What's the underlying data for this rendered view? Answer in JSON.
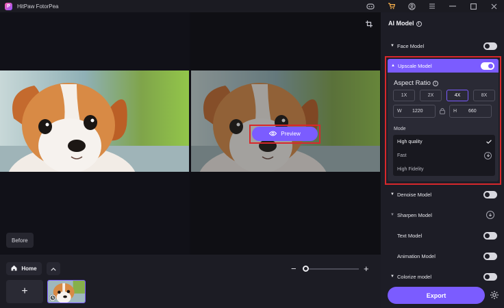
{
  "app": {
    "title": "HitPaw FotorPea",
    "logo_letter": "P"
  },
  "titlebar": {
    "icons": [
      "discord-icon",
      "cart-icon",
      "account-icon",
      "menu-icon",
      "minimize-icon",
      "maximize-icon",
      "close-icon"
    ]
  },
  "canvas": {
    "preview_label": "Preview",
    "before_label": "Before"
  },
  "bottom": {
    "home_label": "Home",
    "add_symbol": "+",
    "zoom_minus": "−",
    "zoom_plus": "+"
  },
  "panel": {
    "title": "AI Model",
    "models": [
      {
        "label": "Face Model",
        "toggle": "off"
      },
      {
        "label": "Upscale Model",
        "toggle": "on",
        "expanded": true
      },
      {
        "label": "Denoise Model",
        "toggle": "off"
      },
      {
        "label": "Sharpen Model",
        "toggle": "download"
      },
      {
        "label": "Text Model",
        "toggle": "off"
      },
      {
        "label": "Animation Model",
        "toggle": "off"
      },
      {
        "label": "Colorize model",
        "toggle": "off"
      }
    ],
    "upscale": {
      "aspect_label": "Aspect Ratio",
      "ratios": [
        "1X",
        "2X",
        "4X",
        "8X"
      ],
      "active_ratio": "4X",
      "width_label": "W",
      "width_value": "1220",
      "height_label": "H",
      "height_value": "660",
      "mode_label": "Mode",
      "modes": [
        {
          "label": "High quality",
          "selected": true
        },
        {
          "label": "Fast",
          "download": true
        },
        {
          "label": "High Fidelity"
        }
      ]
    },
    "export_label": "Export"
  },
  "colors": {
    "accent": "#7b5cff",
    "highlight": "#d8282c"
  }
}
